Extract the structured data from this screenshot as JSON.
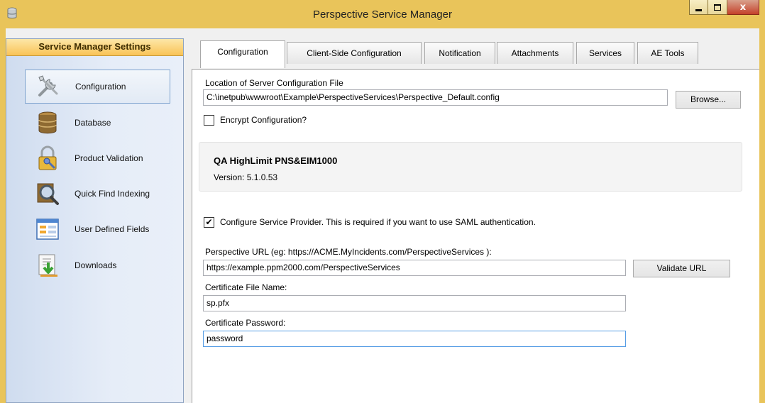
{
  "window": {
    "title": "Perspective Service Manager",
    "minimize_icon": "minimize-icon",
    "maximize_icon": "maximize-icon",
    "close_glyph": "x"
  },
  "sidebar": {
    "header": "Service Manager Settings",
    "items": [
      {
        "label": "Configuration",
        "icon": "tools-icon",
        "selected": true
      },
      {
        "label": "Database",
        "icon": "database-icon",
        "selected": false
      },
      {
        "label": "Product Validation",
        "icon": "padlock-key-icon",
        "selected": false
      },
      {
        "label": "Quick Find Indexing",
        "icon": "magnifier-icon",
        "selected": false
      },
      {
        "label": "User Defined Fields",
        "icon": "form-fields-icon",
        "selected": false
      },
      {
        "label": "Downloads",
        "icon": "download-icon",
        "selected": false
      }
    ]
  },
  "tabs": [
    {
      "label": "Configuration",
      "active": true
    },
    {
      "label": "Client-Side Configuration",
      "active": false
    },
    {
      "label": "Notification",
      "active": false
    },
    {
      "label": "Attachments",
      "active": false
    },
    {
      "label": "Services",
      "active": false
    },
    {
      "label": "AE Tools",
      "active": false
    }
  ],
  "config": {
    "location_label": "Location of Server Configuration File",
    "location_value": "C:\\inetpub\\wwwroot\\Example\\PerspectiveServices\\Perspective_Default.config",
    "browse_label": "Browse...",
    "encrypt_label": "Encrypt Configuration?",
    "encrypt_checked": false,
    "product_name": "QA HighLimit PNS&EIM1000",
    "product_version": "Version: 5.1.0.53",
    "sp_label": "Configure Service Provider. This is required if you want to use SAML authentication.",
    "sp_checked": true,
    "checkmark": "✔",
    "url_label": "Perspective URL (eg: https://ACME.MyIncidents.com/PerspectiveServices ):",
    "url_value": "https://example.ppm2000.com/PerspectiveServices",
    "validate_label": "Validate URL",
    "cert_file_label": "Certificate File Name:",
    "cert_file_value": "sp.pfx",
    "cert_password_label": "Certificate Password:",
    "cert_password_value": "password"
  },
  "colors": {
    "title_bar": "#e9c45a",
    "sidebar_header": "#f9c356",
    "selection_border": "#7da2ce"
  }
}
